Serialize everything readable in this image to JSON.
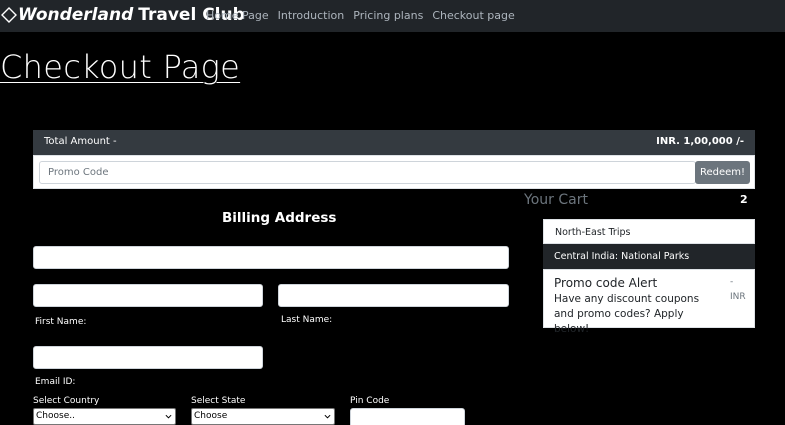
{
  "navbar": {
    "brand_emphasis": "Wonderland",
    "brand_rest": "Travel Club",
    "brand_icon": "diamond-icon",
    "links": [
      "Home Page",
      "Introduction",
      "Pricing plans",
      "Checkout page"
    ]
  },
  "page": {
    "title": "Checkout Page"
  },
  "total": {
    "label": "Total Amount -",
    "amount": "INR. 1,00,000 /-"
  },
  "promo": {
    "placeholder": "Promo Code",
    "button": "Redeem!"
  },
  "cart": {
    "heading": "Your Cart",
    "count": "2",
    "items": [
      "North-East Trips",
      "Central India: National Parks"
    ],
    "alert": {
      "title": "Promo code Alert",
      "text": "Have any discount coupons and promo codes? Apply below!",
      "dash": "-",
      "currency": "INR"
    }
  },
  "billing": {
    "heading": "Billing Address",
    "first_name_label": "First Name:",
    "last_name_label": "Last Name:",
    "email_label": "Email ID:",
    "country_label": "Select Country",
    "country_value": "Choose..",
    "state_label": "Select State",
    "state_value": "Choose",
    "pin_label": "Pin Code"
  },
  "colors": {
    "navbar": "#212529",
    "total_bar": "#343a40",
    "redeem": "#6c757d",
    "background": "#000000"
  }
}
